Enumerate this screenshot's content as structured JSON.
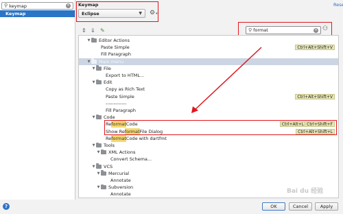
{
  "left": {
    "search_value": "keymap",
    "items": [
      {
        "label": "Keymap"
      }
    ]
  },
  "header": {
    "title": "Keymap",
    "reset_label": "Reset"
  },
  "scheme": {
    "selected": "Eclipse"
  },
  "search": {
    "value": "format"
  },
  "colors": {
    "accent": "#2a75c6",
    "highlight_box": "#e0151c",
    "match_highlight": "#f5d870",
    "shortcut_bg": "#e6e6b6",
    "group_row": "#cbd5e3"
  },
  "tree": {
    "rows": [
      {
        "label": "Editor Actions",
        "indent": 1,
        "arrow": "▼",
        "folder": true
      },
      {
        "label": "Paste Simple",
        "indent": 3,
        "shortcuts": [
          "Ctrl+Alt+Shift+V"
        ]
      },
      {
        "label": "Fill Paragraph",
        "indent": 3
      },
      {
        "label": "Main menu",
        "indent": 1,
        "arrow": "▼",
        "folder": true,
        "header": true
      },
      {
        "label": "File",
        "indent": 2,
        "arrow": "▼",
        "folder": true
      },
      {
        "label": "Export to HTML...",
        "indent": 4
      },
      {
        "label": "Edit",
        "indent": 2,
        "arrow": "▼",
        "folder": true
      },
      {
        "label": "Copy as Rich Text",
        "indent": 4
      },
      {
        "label": "Paste Simple",
        "indent": 4,
        "shortcuts": [
          "Ctrl+Alt+Shift+V"
        ]
      },
      {
        "label": "-------------",
        "indent": 4
      },
      {
        "label": "Fill Paragraph",
        "indent": 4
      },
      {
        "label": "Code",
        "indent": 2,
        "arrow": "▼",
        "folder": true
      },
      {
        "pre": "Re",
        "match": "format",
        "post": " Code",
        "indent": 4,
        "shortcuts": [
          "Ctrl+Alt+L",
          "Ctrl+Shift+F"
        ]
      },
      {
        "pre": "Show Re",
        "match": "format",
        "post": " File Dialog",
        "indent": 4,
        "shortcuts": [
          "Ctrl+Alt+Shift+L"
        ]
      },
      {
        "pre": "Re",
        "match": "format",
        "post": " Code with dartfmt",
        "indent": 4
      },
      {
        "label": "Tools",
        "indent": 2,
        "arrow": "▼",
        "folder": true
      },
      {
        "label": "XML Actions",
        "indent": 3,
        "arrow": "▼",
        "folder": true
      },
      {
        "label": "Convert Schema...",
        "indent": 5
      },
      {
        "label": "VCS",
        "indent": 2,
        "arrow": "▼",
        "folder": true
      },
      {
        "label": "Mercurial",
        "indent": 3,
        "arrow": "▼",
        "folder": true
      },
      {
        "label": "Annotate",
        "indent": 5
      },
      {
        "label": "Subversion",
        "indent": 3,
        "arrow": "▼",
        "folder": true
      },
      {
        "label": "Annotate",
        "indent": 5
      }
    ]
  },
  "watermark": "Bai du 经验",
  "footer": {
    "ok": "OK",
    "cancel": "Cancel",
    "apply": "Apply"
  }
}
